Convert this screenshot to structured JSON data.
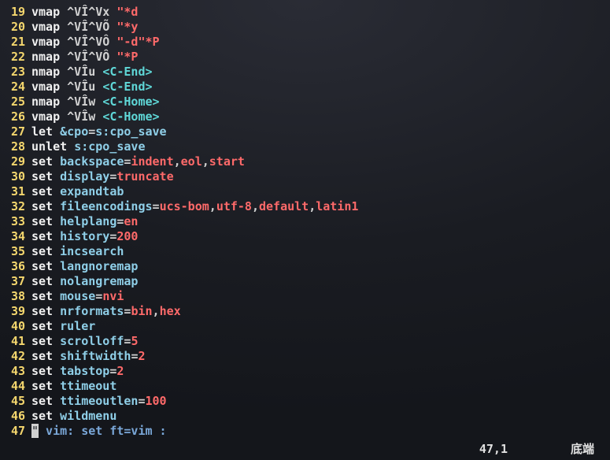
{
  "lines": [
    {
      "n": 19,
      "tokens": [
        [
          "kw-cmd",
          "vmap"
        ],
        [
          "str",
          " ^VÎ^Vx "
        ],
        [
          "red",
          "\"*d"
        ]
      ]
    },
    {
      "n": 20,
      "tokens": [
        [
          "kw-cmd",
          "vmap"
        ],
        [
          "str",
          " ^VÎ^VÕ "
        ],
        [
          "red",
          "\"*y"
        ]
      ]
    },
    {
      "n": 21,
      "tokens": [
        [
          "kw-cmd",
          "vmap"
        ],
        [
          "str",
          " ^VÎ^VÔ "
        ],
        [
          "red",
          "\"-d\"*P"
        ]
      ]
    },
    {
      "n": 22,
      "tokens": [
        [
          "kw-cmd",
          "nmap"
        ],
        [
          "str",
          " ^VÎ^VÔ "
        ],
        [
          "red",
          "\"*P"
        ]
      ]
    },
    {
      "n": 23,
      "tokens": [
        [
          "kw-cmd",
          "nmap"
        ],
        [
          "str",
          " ^VÎu "
        ],
        [
          "cyan",
          "<C-End>"
        ]
      ]
    },
    {
      "n": 24,
      "tokens": [
        [
          "kw-cmd",
          "vmap"
        ],
        [
          "str",
          " ^VÎu "
        ],
        [
          "cyan",
          "<C-End>"
        ]
      ]
    },
    {
      "n": 25,
      "tokens": [
        [
          "kw-cmd",
          "nmap"
        ],
        [
          "str",
          " ^VÎw "
        ],
        [
          "cyan",
          "<C-Home>"
        ]
      ]
    },
    {
      "n": 26,
      "tokens": [
        [
          "kw-cmd",
          "vmap"
        ],
        [
          "str",
          " ^VÎw "
        ],
        [
          "cyan",
          "<C-Home>"
        ]
      ]
    },
    {
      "n": 27,
      "tokens": [
        [
          "kw-cmd",
          "let"
        ],
        [
          "str",
          " "
        ],
        [
          "opt",
          "&cpo"
        ],
        [
          "punct",
          "="
        ],
        [
          "opt",
          "s:cpo_save"
        ]
      ]
    },
    {
      "n": 28,
      "tokens": [
        [
          "kw-cmd",
          "unlet"
        ],
        [
          "str",
          " "
        ],
        [
          "opt",
          "s:cpo_save"
        ]
      ]
    },
    {
      "n": 29,
      "tokens": [
        [
          "kw-cmd",
          "set"
        ],
        [
          "str",
          " "
        ],
        [
          "opt",
          "backspace"
        ],
        [
          "punct",
          "="
        ],
        [
          "red",
          "indent"
        ],
        [
          "punct",
          ","
        ],
        [
          "red",
          "eol"
        ],
        [
          "punct",
          ","
        ],
        [
          "red",
          "start"
        ]
      ]
    },
    {
      "n": 30,
      "tokens": [
        [
          "kw-cmd",
          "set"
        ],
        [
          "str",
          " "
        ],
        [
          "opt",
          "display"
        ],
        [
          "punct",
          "="
        ],
        [
          "red",
          "truncate"
        ]
      ]
    },
    {
      "n": 31,
      "tokens": [
        [
          "kw-cmd",
          "set"
        ],
        [
          "str",
          " "
        ],
        [
          "opt",
          "expandtab"
        ]
      ]
    },
    {
      "n": 32,
      "tokens": [
        [
          "kw-cmd",
          "set"
        ],
        [
          "str",
          " "
        ],
        [
          "opt",
          "fileencodings"
        ],
        [
          "punct",
          "="
        ],
        [
          "red",
          "ucs-bom"
        ],
        [
          "punct",
          ","
        ],
        [
          "red",
          "utf-8"
        ],
        [
          "punct",
          ","
        ],
        [
          "red",
          "default"
        ],
        [
          "punct",
          ","
        ],
        [
          "red",
          "latin1"
        ]
      ]
    },
    {
      "n": 33,
      "tokens": [
        [
          "kw-cmd",
          "set"
        ],
        [
          "str",
          " "
        ],
        [
          "opt",
          "helplang"
        ],
        [
          "punct",
          "="
        ],
        [
          "red",
          "en"
        ]
      ]
    },
    {
      "n": 34,
      "tokens": [
        [
          "kw-cmd",
          "set"
        ],
        [
          "str",
          " "
        ],
        [
          "opt",
          "history"
        ],
        [
          "punct",
          "="
        ],
        [
          "red",
          "200"
        ]
      ]
    },
    {
      "n": 35,
      "tokens": [
        [
          "kw-cmd",
          "set"
        ],
        [
          "str",
          " "
        ],
        [
          "opt",
          "incsearch"
        ]
      ]
    },
    {
      "n": 36,
      "tokens": [
        [
          "kw-cmd",
          "set"
        ],
        [
          "str",
          " "
        ],
        [
          "opt",
          "langnoremap"
        ]
      ]
    },
    {
      "n": 37,
      "tokens": [
        [
          "kw-cmd",
          "set"
        ],
        [
          "str",
          " "
        ],
        [
          "opt",
          "nolangremap"
        ]
      ]
    },
    {
      "n": 38,
      "tokens": [
        [
          "kw-cmd",
          "set"
        ],
        [
          "str",
          " "
        ],
        [
          "opt",
          "mouse"
        ],
        [
          "punct",
          "="
        ],
        [
          "red",
          "nvi"
        ]
      ]
    },
    {
      "n": 39,
      "tokens": [
        [
          "kw-cmd",
          "set"
        ],
        [
          "str",
          " "
        ],
        [
          "opt",
          "nrformats"
        ],
        [
          "punct",
          "="
        ],
        [
          "red",
          "bin"
        ],
        [
          "punct",
          ","
        ],
        [
          "red",
          "hex"
        ]
      ]
    },
    {
      "n": 40,
      "tokens": [
        [
          "kw-cmd",
          "set"
        ],
        [
          "str",
          " "
        ],
        [
          "opt",
          "ruler"
        ]
      ]
    },
    {
      "n": 41,
      "tokens": [
        [
          "kw-cmd",
          "set"
        ],
        [
          "str",
          " "
        ],
        [
          "opt",
          "scrolloff"
        ],
        [
          "punct",
          "="
        ],
        [
          "red",
          "5"
        ]
      ]
    },
    {
      "n": 42,
      "tokens": [
        [
          "kw-cmd",
          "set"
        ],
        [
          "str",
          " "
        ],
        [
          "opt",
          "shiftwidth"
        ],
        [
          "punct",
          "="
        ],
        [
          "red",
          "2"
        ]
      ]
    },
    {
      "n": 43,
      "tokens": [
        [
          "kw-cmd",
          "set"
        ],
        [
          "str",
          " "
        ],
        [
          "opt",
          "tabstop"
        ],
        [
          "punct",
          "="
        ],
        [
          "red",
          "2"
        ]
      ]
    },
    {
      "n": 44,
      "tokens": [
        [
          "kw-cmd",
          "set"
        ],
        [
          "str",
          " "
        ],
        [
          "opt",
          "ttimeout"
        ]
      ]
    },
    {
      "n": 45,
      "tokens": [
        [
          "kw-cmd",
          "set"
        ],
        [
          "str",
          " "
        ],
        [
          "opt",
          "ttimeoutlen"
        ],
        [
          "punct",
          "="
        ],
        [
          "red",
          "100"
        ]
      ]
    },
    {
      "n": 46,
      "tokens": [
        [
          "kw-cmd",
          "set"
        ],
        [
          "str",
          " "
        ],
        [
          "opt",
          "wildmenu"
        ]
      ]
    },
    {
      "n": 47,
      "tokens": [
        [
          "cursor",
          "\""
        ],
        [
          "comment",
          " vim: set ft=vim :"
        ]
      ]
    }
  ],
  "status": {
    "position": "47,1",
    "location": "底端"
  }
}
